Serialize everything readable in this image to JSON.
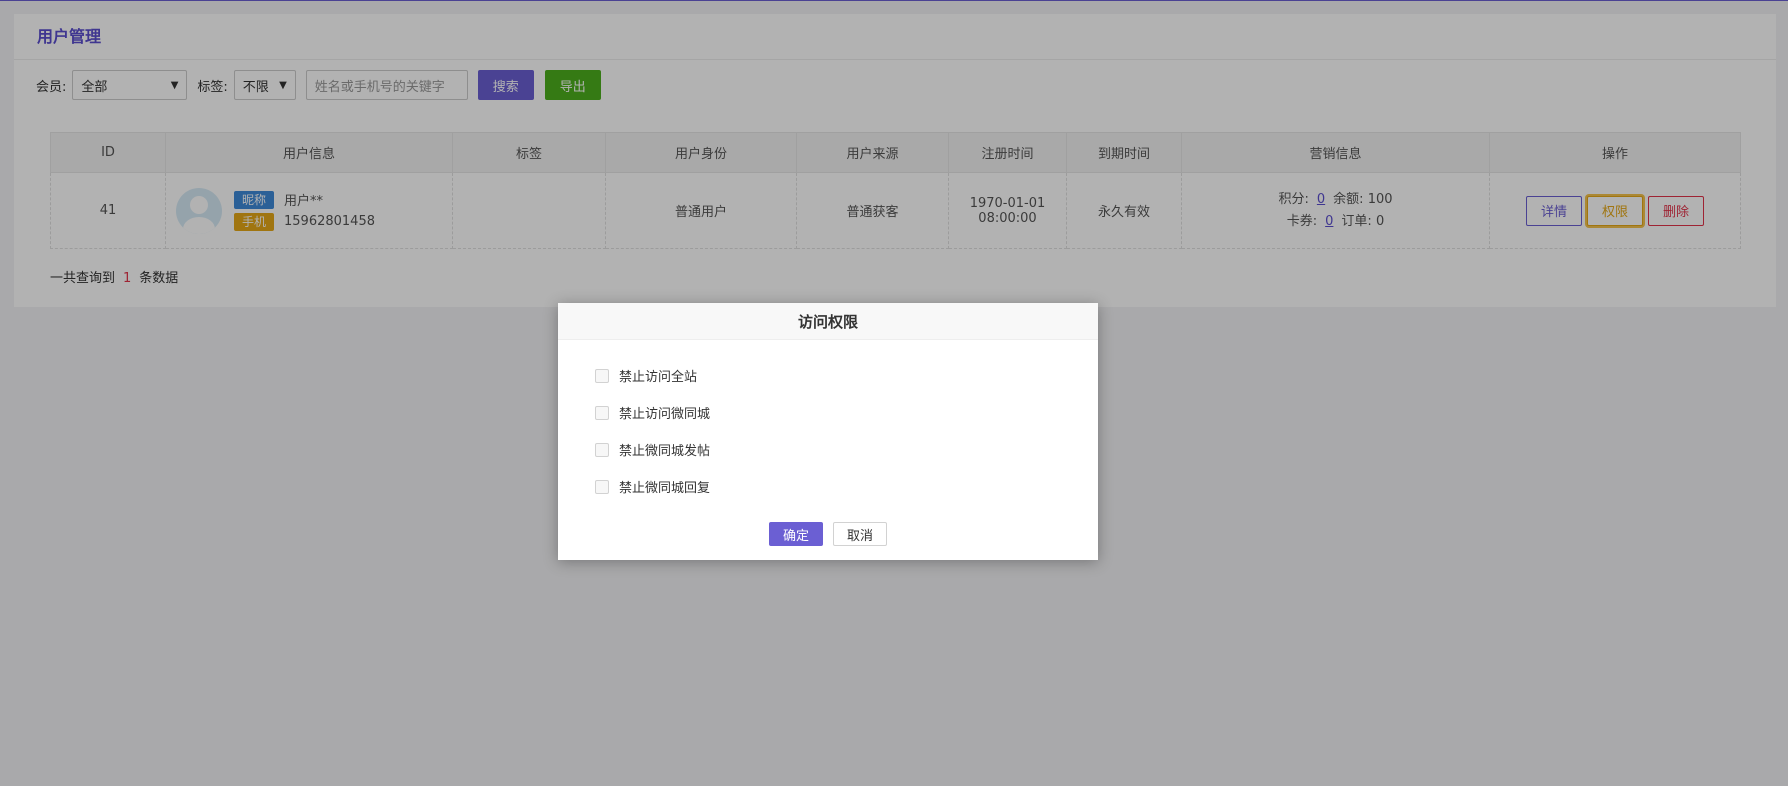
{
  "header": {
    "title": "用户管理"
  },
  "filters": {
    "member_label": "会员:",
    "member_value": "全部",
    "tag_label": "标签:",
    "tag_value": "不限",
    "search_placeholder": "姓名或手机号的关键字",
    "search_button": "搜索",
    "export_button": "导出"
  },
  "table": {
    "columns": [
      "ID",
      "用户信息",
      "标签",
      "用户身份",
      "用户来源",
      "注册时间",
      "到期时间",
      "营销信息",
      "操作"
    ],
    "rows": [
      {
        "id": "41",
        "nickname_badge": "昵称",
        "nickname": "用户**",
        "phone_badge": "手机",
        "phone": "15962801458",
        "tag": "",
        "identity": "普通用户",
        "source": "普通获客",
        "reg_date": "1970-01-01",
        "reg_time": "08:00:00",
        "expiry": "永久有效",
        "points_label": "积分:",
        "points": "0",
        "balance_label": "余额:",
        "balance": "100",
        "coupon_label": "卡券:",
        "coupon": "0",
        "order_label": "订单:",
        "order": "0",
        "actions": {
          "detail": "详情",
          "permission": "权限",
          "delete": "删除"
        }
      }
    ]
  },
  "summary": {
    "prefix": "一共查询到",
    "count": "1",
    "suffix": "条数据"
  },
  "dialog": {
    "title": "访问权限",
    "options": [
      "禁止访问全站",
      "禁止访问微同城",
      "禁止微同城发帖",
      "禁止微同城回复"
    ],
    "confirm": "确定",
    "cancel": "取消"
  },
  "colors": {
    "accent": "#6b5fd3",
    "export": "#4caf1e",
    "warning": "#e6a817",
    "danger": "#e2334a",
    "info": "#3e8ad8"
  }
}
